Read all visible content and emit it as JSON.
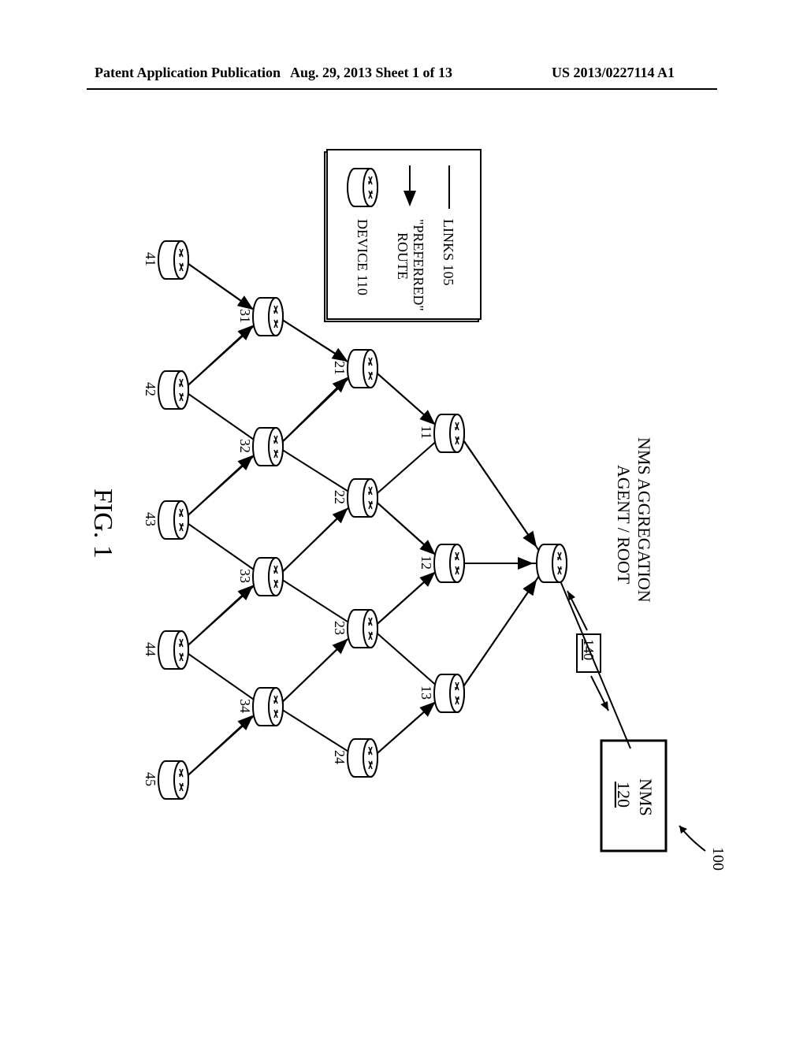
{
  "header": {
    "left": "Patent Application Publication",
    "mid": "Aug. 29, 2013  Sheet 1 of 13",
    "right": "US 2013/0227114 A1"
  },
  "figure": {
    "caption": "FIG. 1",
    "ref_100": "100",
    "nms_label_1": "NMS",
    "nms_label_2": "120",
    "agent_root_1": "NMS AGGREGATION",
    "agent_root_2": "AGENT / ROOT",
    "ref_140": "140",
    "legend": {
      "links": "LINKS 105",
      "preferred_1": "\"PREFERRED\"",
      "preferred_2": "ROUTE",
      "device": "DEVICE 110"
    },
    "nodes": {
      "n11": "11",
      "n12": "12",
      "n13": "13",
      "n21": "21",
      "n22": "22",
      "n23": "23",
      "n24": "24",
      "n31": "31",
      "n32": "32",
      "n33": "33",
      "n34": "34",
      "n41": "41",
      "n42": "42",
      "n43": "43",
      "n44": "44",
      "n45": "45"
    }
  }
}
